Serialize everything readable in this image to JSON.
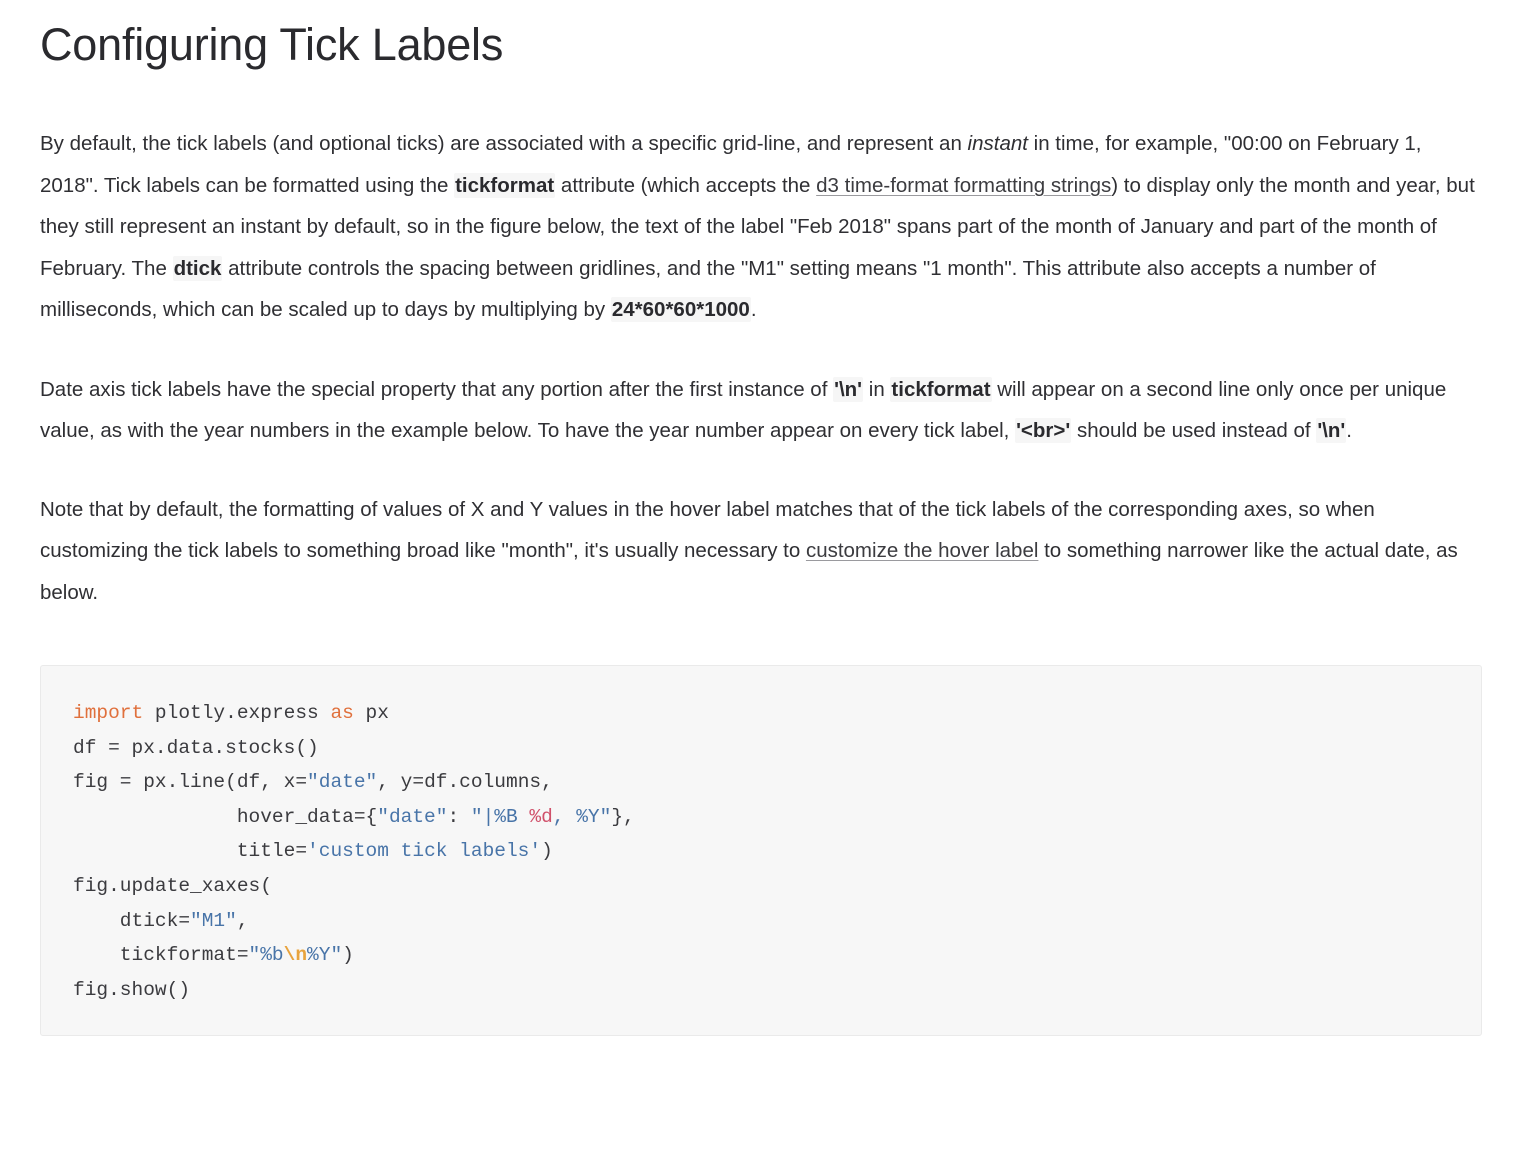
{
  "page": {
    "title": "Configuring Tick Labels",
    "background_color": "#ffffff",
    "text_color": "#2f2f33"
  },
  "paragraphs": {
    "p1": {
      "s1": "By default, the tick labels (and optional ticks) are associated with a specific grid-line, and represent an ",
      "em1": "instant",
      "s2": " in time, for example, \"00:00 on February 1, 2018\". Tick labels can be formatted using the ",
      "code1": "tickformat",
      "s3": " attribute (which accepts the ",
      "link1": "d3 time-format formatting strings",
      "s4": ") to display only the month and year, but they still represent an instant by default, so in the figure below, the text of the label \"Feb 2018\" spans part of the month of January and part of the month of February. The ",
      "code2": "dtick",
      "s5": " attribute controls the spacing between gridlines, and the \"M1\" setting means \"1 month\". This attribute also accepts a number of milliseconds, which can be scaled up to days by multiplying by ",
      "code3": "24*60*60*1000",
      "s6": "."
    },
    "p2": {
      "s1": "Date axis tick labels have the special property that any portion after the first instance of ",
      "code1": "'\\n'",
      "s2": " in ",
      "code2": "tickformat",
      "s3": " will appear on a second line only once per unique value, as with the year numbers in the example below. To have the year number appear on every tick label, ",
      "code3": "'<br>'",
      "s4": " should be used instead of ",
      "code4": "'\\n'",
      "s5": "."
    },
    "p3": {
      "s1": "Note that by default, the formatting of values of X and Y values in the hover label matches that of the tick labels of the corresponding axes, so when customizing the tick labels to something broad like \"month\", it's usually necessary to ",
      "link1": "customize the hover label",
      "s2": " to something narrower like the actual date, as below."
    }
  },
  "code_block": {
    "language": "python",
    "background_color": "#f7f7f7",
    "border_color": "#eaeaea",
    "colors": {
      "keyword": "#e0703c",
      "string": "#4874a8",
      "escape": "#e8a33d",
      "format_spec": "#d0506a",
      "plain": "#3b3b3f"
    },
    "lines": [
      [
        {
          "t": "import",
          "c": "kw"
        },
        {
          "t": " plotly.express ",
          "c": "pl"
        },
        {
          "t": "as",
          "c": "kw"
        },
        {
          "t": " px",
          "c": "pl"
        }
      ],
      [
        {
          "t": "df = px.data.stocks()",
          "c": "pl"
        }
      ],
      [
        {
          "t": "fig = px.line(df, x=",
          "c": "pl"
        },
        {
          "t": "\"date\"",
          "c": "str"
        },
        {
          "t": ", y=df.columns,",
          "c": "pl"
        }
      ],
      [
        {
          "t": "              hover_data={",
          "c": "pl"
        },
        {
          "t": "\"date\"",
          "c": "str"
        },
        {
          "t": ": ",
          "c": "pl"
        },
        {
          "t": "\"|%B ",
          "c": "str"
        },
        {
          "t": "%d",
          "c": "fmt"
        },
        {
          "t": ", %Y\"",
          "c": "str"
        },
        {
          "t": "},",
          "c": "pl"
        }
      ],
      [
        {
          "t": "              title=",
          "c": "pl"
        },
        {
          "t": "'custom tick labels'",
          "c": "str"
        },
        {
          "t": ")",
          "c": "pl"
        }
      ],
      [
        {
          "t": "fig.update_xaxes(",
          "c": "pl"
        }
      ],
      [
        {
          "t": "    dtick=",
          "c": "pl"
        },
        {
          "t": "\"M1\"",
          "c": "str"
        },
        {
          "t": ",",
          "c": "pl"
        }
      ],
      [
        {
          "t": "    tickformat=",
          "c": "pl"
        },
        {
          "t": "\"%b",
          "c": "str"
        },
        {
          "t": "\\n",
          "c": "esc"
        },
        {
          "t": "%Y\"",
          "c": "str"
        },
        {
          "t": ")",
          "c": "pl"
        }
      ],
      [
        {
          "t": "fig.show()",
          "c": "pl"
        }
      ]
    ]
  }
}
